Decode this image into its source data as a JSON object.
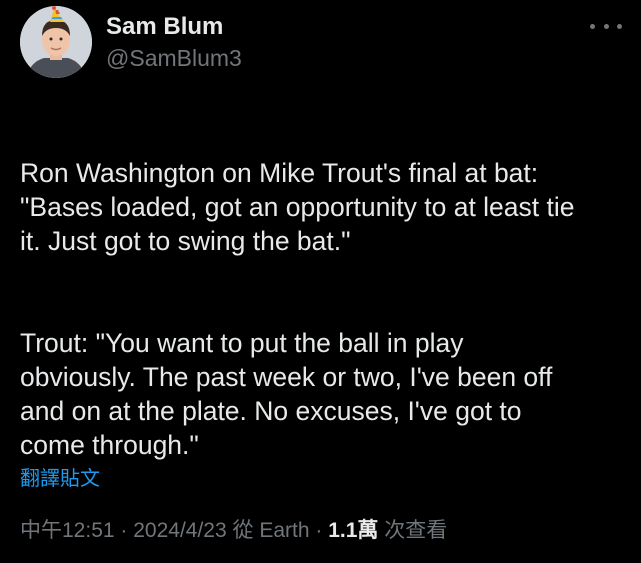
{
  "author": {
    "display_name": "Sam Blum",
    "handle": "@SamBlum3",
    "avatar_icon": "profile-photo-party-hat"
  },
  "more_icon": "more-horizontal-icon",
  "tweet": {
    "paragraph1": "Ron Washington on Mike Trout's final at bat:\n\"Bases loaded, got an opportunity to at least tie\nit. Just got to swing the bat.\"",
    "paragraph2": "Trout: \"You want to put the ball in play\nobviously. The past week or two, I've been off\nand on at the plate. No excuses, I've got to\ncome through.\""
  },
  "translate_link": "翻譯貼文",
  "meta": {
    "time": "中午12:51",
    "sep1": " · ",
    "date": "2024/4/23",
    "source": " 從 Earth",
    "sep2": " · ",
    "views_count": "1.1萬",
    "views_label": " 次查看"
  },
  "colors": {
    "background": "#000000",
    "text": "#e7e9ea",
    "secondary": "#71767b",
    "link": "#1d9bf0"
  }
}
